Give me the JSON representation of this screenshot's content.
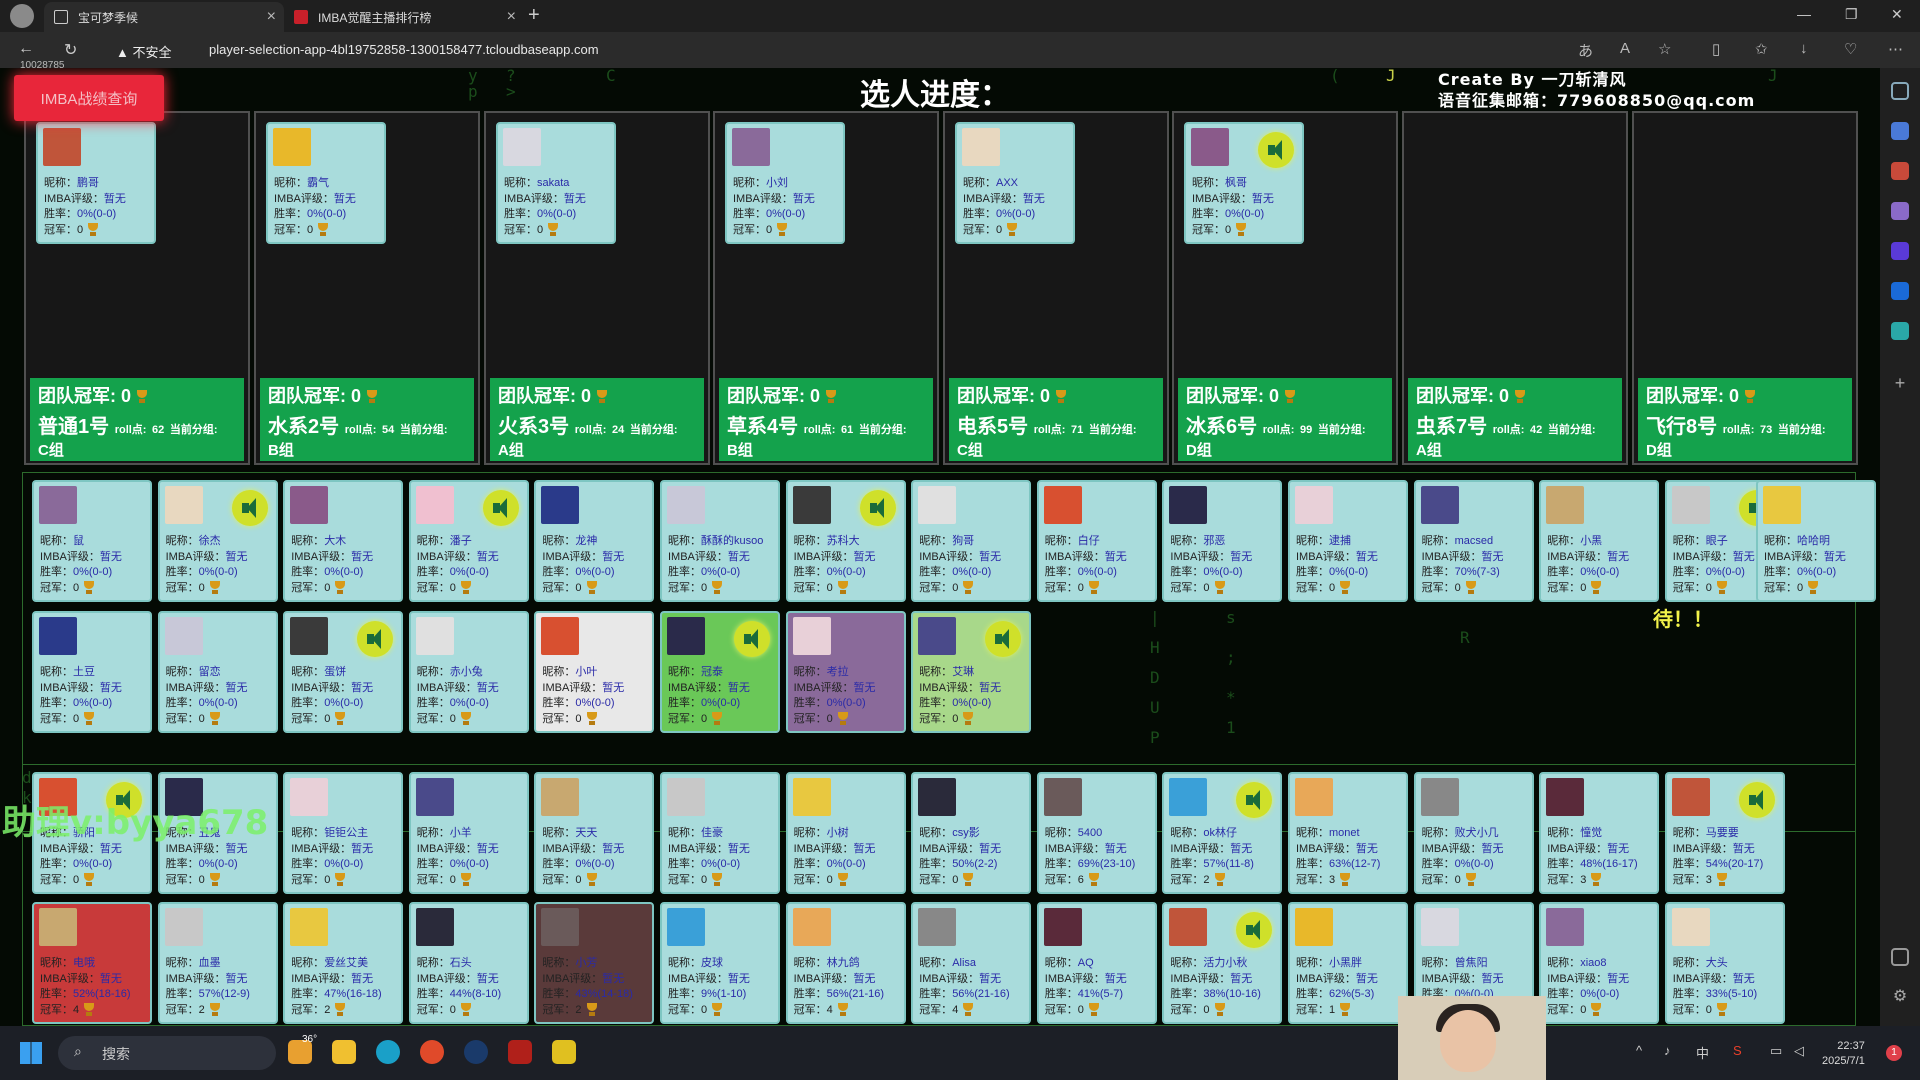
{
  "browser": {
    "tabs": [
      {
        "label": "宝可梦季候"
      },
      {
        "label": "IMBA觉醒主播排行榜"
      }
    ],
    "security_label": "不安全",
    "url": "player-selection-app-4bl19752858-1300158477.tcloudbaseapp.com",
    "profile_id": "10028785"
  },
  "page": {
    "title": "选人进度：",
    "credit_line1": "Create By 一刀斩清风",
    "credit_line2": "语音征集邮箱：779608850@qq.com",
    "query_button": "IMBA战绩查询",
    "waiting_text": "待！！",
    "watermark": "助理v:byya678"
  },
  "labels": {
    "nick": "昵称：",
    "rating": "IMBA评级：",
    "winrate": "胜率：",
    "champ": "冠军：",
    "team_champ": "团队冠军:",
    "roll": "roll点:",
    "group_label": "当前分组:"
  },
  "teams": [
    {
      "champ": "0",
      "name": "普通1号",
      "roll": "62",
      "group": "C组"
    },
    {
      "champ": "0",
      "name": "水系2号",
      "roll": "54",
      "group": "B组"
    },
    {
      "champ": "0",
      "name": "火系3号",
      "roll": "24",
      "group": "A组"
    },
    {
      "champ": "0",
      "name": "草系4号",
      "roll": "61",
      "group": "B组"
    },
    {
      "champ": "0",
      "name": "电系5号",
      "roll": "71",
      "group": "C组"
    },
    {
      "champ": "0",
      "name": "冰系6号",
      "roll": "99",
      "group": "D组"
    },
    {
      "champ": "0",
      "name": "虫系7号",
      "roll": "42",
      "group": "A组"
    },
    {
      "champ": "0",
      "name": "飞行8号",
      "roll": "73",
      "group": "D组"
    }
  ],
  "team_leaders": [
    {
      "nick": "鹏哥",
      "rating": "暂无",
      "winrate": "0%(0-0)",
      "champ": "0"
    },
    {
      "nick": "霸气",
      "rating": "暂无",
      "winrate": "0%(0-0)",
      "champ": "0"
    },
    {
      "nick": "sakata",
      "rating": "暂无",
      "winrate": "0%(0-0)",
      "champ": "0"
    },
    {
      "nick": "小刘",
      "rating": "暂无",
      "winrate": "0%(0-0)",
      "champ": "0"
    },
    {
      "nick": "AXX",
      "rating": "暂无",
      "winrate": "0%(0-0)",
      "champ": "0"
    },
    {
      "nick": "枫哥",
      "rating": "暂无",
      "winrate": "0%(0-0)",
      "champ": "0"
    }
  ],
  "pool_row1": [
    {
      "nick": "鼠",
      "rating": "暂无",
      "winrate": "0%(0-0)",
      "champ": "0"
    },
    {
      "nick": "徐杰",
      "rating": "暂无",
      "winrate": "0%(0-0)",
      "champ": "0"
    },
    {
      "nick": "大木",
      "rating": "暂无",
      "winrate": "0%(0-0)",
      "champ": "0"
    },
    {
      "nick": "潘子",
      "rating": "暂无",
      "winrate": "0%(0-0)",
      "champ": "0"
    },
    {
      "nick": "龙神",
      "rating": "暂无",
      "winrate": "0%(0-0)",
      "champ": "0"
    },
    {
      "nick": "酥酥的kusoo",
      "rating": "暂无",
      "winrate": "0%(0-0)",
      "champ": "0"
    },
    {
      "nick": "苏科大",
      "rating": "暂无",
      "winrate": "0%(0-0)",
      "champ": "0"
    },
    {
      "nick": "狗哥",
      "rating": "暂无",
      "winrate": "0%(0-0)",
      "champ": "0"
    },
    {
      "nick": "白仔",
      "rating": "暂无",
      "winrate": "0%(0-0)",
      "champ": "0"
    },
    {
      "nick": "邪恶",
      "rating": "暂无",
      "winrate": "0%(0-0)",
      "champ": "0"
    },
    {
      "nick": "逮捕",
      "rating": "暂无",
      "winrate": "0%(0-0)",
      "champ": "0"
    },
    {
      "nick": "macsed",
      "rating": "暂无",
      "winrate": "70%(7-3)",
      "champ": "0"
    },
    {
      "nick": "小黑",
      "rating": "暂无",
      "winrate": "0%(0-0)",
      "champ": "0"
    },
    {
      "nick": "眼子",
      "rating": "暂无",
      "winrate": "0%(0-0)",
      "champ": "0"
    },
    {
      "nick": "哈哈明",
      "rating": "暂无",
      "winrate": "0%(0-0)",
      "champ": "0"
    }
  ],
  "pool_row2": [
    {
      "nick": "土豆",
      "rating": "暂无",
      "winrate": "0%(0-0)",
      "champ": "0"
    },
    {
      "nick": "留恋",
      "rating": "暂无",
      "winrate": "0%(0-0)",
      "champ": "0"
    },
    {
      "nick": "蛋饼",
      "rating": "暂无",
      "winrate": "0%(0-0)",
      "champ": "0"
    },
    {
      "nick": "赤小兔",
      "rating": "暂无",
      "winrate": "0%(0-0)",
      "champ": "0"
    },
    {
      "nick": "小叶",
      "rating": "暂无",
      "winrate": "0%(0-0)",
      "champ": "0"
    },
    {
      "nick": "冠泰",
      "rating": "暂无",
      "winrate": "0%(0-0)",
      "champ": "0"
    },
    {
      "nick": "考拉",
      "rating": "暂无",
      "winrate": "0%(0-0)",
      "champ": "0"
    },
    {
      "nick": "艾琳",
      "rating": "暂无",
      "winrate": "0%(0-0)",
      "champ": "0"
    }
  ],
  "pool_row3": [
    {
      "nick": "骄阳",
      "rating": "暂无",
      "winrate": "0%(0-0)",
      "champ": "0"
    },
    {
      "nick": "丑鬼",
      "rating": "暂无",
      "winrate": "0%(0-0)",
      "champ": "0"
    },
    {
      "nick": "钜钜公主",
      "rating": "暂无",
      "winrate": "0%(0-0)",
      "champ": "0"
    },
    {
      "nick": "小羊",
      "rating": "暂无",
      "winrate": "0%(0-0)",
      "champ": "0"
    },
    {
      "nick": "天天",
      "rating": "暂无",
      "winrate": "0%(0-0)",
      "champ": "0"
    },
    {
      "nick": "佳豪",
      "rating": "暂无",
      "winrate": "0%(0-0)",
      "champ": "0"
    },
    {
      "nick": "小树",
      "rating": "暂无",
      "winrate": "0%(0-0)",
      "champ": "0"
    },
    {
      "nick": "csy影",
      "rating": "暂无",
      "winrate": "50%(2-2)",
      "champ": "0"
    },
    {
      "nick": "5400",
      "rating": "暂无",
      "winrate": "69%(23-10)",
      "champ": "6"
    },
    {
      "nick": "ok林仔",
      "rating": "暂无",
      "winrate": "57%(11-8)",
      "champ": "2"
    },
    {
      "nick": "monet",
      "rating": "暂无",
      "winrate": "63%(12-7)",
      "champ": "3"
    },
    {
      "nick": "败犬小几",
      "rating": "暂无",
      "winrate": "0%(0-0)",
      "champ": "0"
    },
    {
      "nick": "憧觉",
      "rating": "暂无",
      "winrate": "48%(16-17)",
      "champ": "3"
    },
    {
      "nick": "马要要",
      "rating": "暂无",
      "winrate": "54%(20-17)",
      "champ": "3"
    }
  ],
  "pool_row4": [
    {
      "nick": "电哦",
      "rating": "暂无",
      "winrate": "52%(18-16)",
      "champ": "4"
    },
    {
      "nick": "血墨",
      "rating": "暂无",
      "winrate": "57%(12-9)",
      "champ": "2"
    },
    {
      "nick": "爱丝艾美",
      "rating": "暂无",
      "winrate": "47%(16-18)",
      "champ": "2"
    },
    {
      "nick": "石头",
      "rating": "暂无",
      "winrate": "44%(8-10)",
      "champ": "0"
    },
    {
      "nick": "小芳",
      "rating": "暂无",
      "winrate": "43%(14-18)",
      "champ": "2"
    },
    {
      "nick": "皮球",
      "rating": "暂无",
      "winrate": "9%(1-10)",
      "champ": "0"
    },
    {
      "nick": "林九鸽",
      "rating": "暂无",
      "winrate": "56%(21-16)",
      "champ": "4"
    },
    {
      "nick": "Alisa",
      "rating": "暂无",
      "winrate": "56%(21-16)",
      "champ": "4"
    },
    {
      "nick": "AQ",
      "rating": "暂无",
      "winrate": "41%(5-7)",
      "champ": "0"
    },
    {
      "nick": "活力小秋",
      "rating": "暂无",
      "winrate": "38%(10-16)",
      "champ": "0"
    },
    {
      "nick": "小黑胖",
      "rating": "暂无",
      "winrate": "62%(5-3)",
      "champ": "1"
    },
    {
      "nick": "曾焦阳",
      "rating": "暂无",
      "winrate": "0%(0-0)",
      "champ": "0"
    },
    {
      "nick": "xiao8",
      "rating": "暂无",
      "winrate": "0%(0-0)",
      "champ": "0"
    },
    {
      "nick": "大头",
      "rating": "暂无",
      "winrate": "33%(5-10)",
      "champ": "0"
    }
  ],
  "taskbar": {
    "search": "搜索",
    "weather": "36°",
    "time": "22:37",
    "date": "2025/7/1",
    "ime": "中",
    "notif": "1"
  },
  "colors": {
    "card_bg": "#a9dcdc",
    "team_footer": "#14a24c",
    "query_button": "#e8263a",
    "waiting_text": "#f2f24a"
  }
}
